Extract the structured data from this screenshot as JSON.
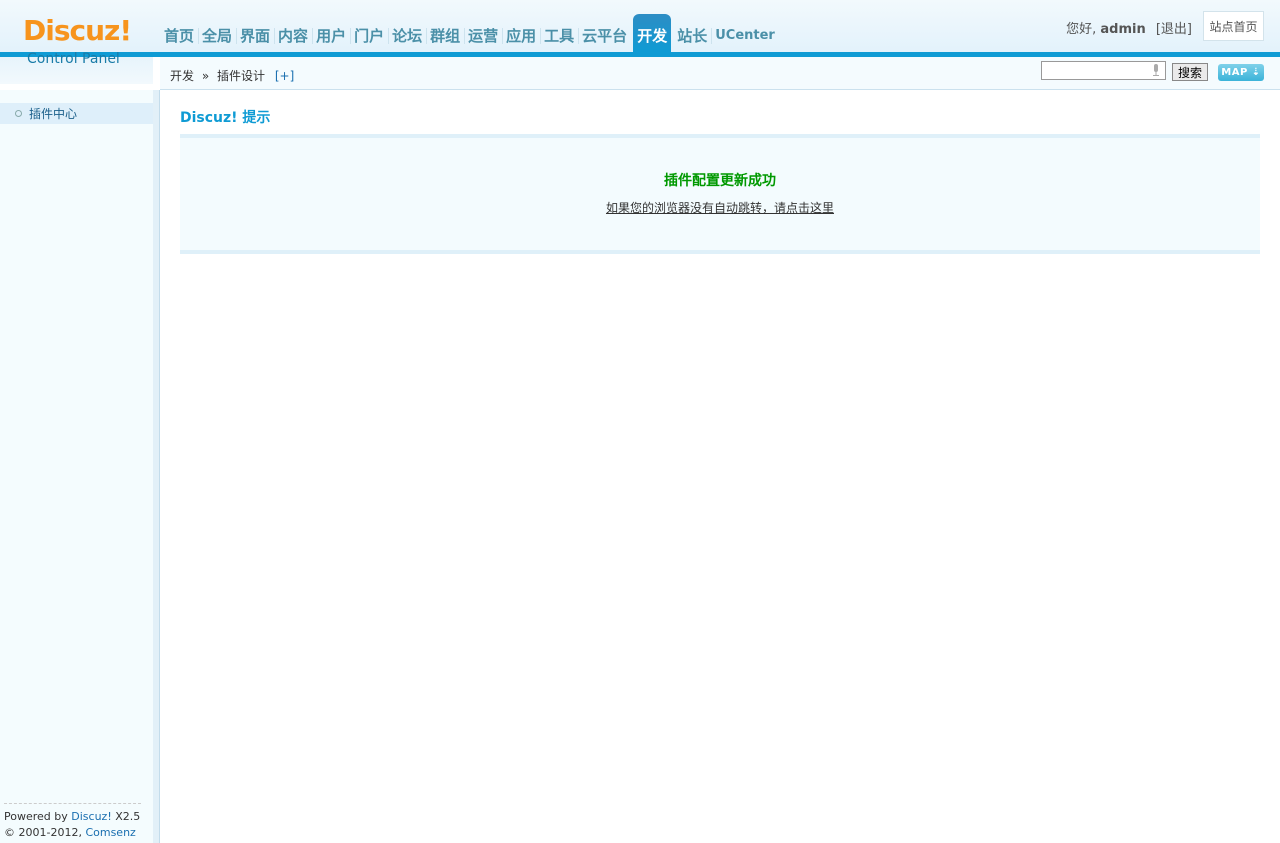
{
  "logo": {
    "brand": "Discuz!",
    "subtitle": "Control Panel"
  },
  "nav": {
    "items": [
      {
        "label": "首页"
      },
      {
        "label": "全局"
      },
      {
        "label": "界面"
      },
      {
        "label": "内容"
      },
      {
        "label": "用户"
      },
      {
        "label": "门户"
      },
      {
        "label": "论坛"
      },
      {
        "label": "群组"
      },
      {
        "label": "运营"
      },
      {
        "label": "应用"
      },
      {
        "label": "工具"
      },
      {
        "label": "云平台"
      },
      {
        "label": "开发",
        "active": true
      },
      {
        "label": "站长"
      },
      {
        "label": "UCenter"
      }
    ]
  },
  "user": {
    "greeting": "您好,",
    "name": "admin",
    "logout": "[退出]",
    "site_home": "站点首页"
  },
  "breadcrumb": {
    "root": "开发",
    "sep": "»",
    "current": "插件设计",
    "add": "[+]"
  },
  "search": {
    "value": "",
    "button": "搜索",
    "map_button": "MAP ⇣"
  },
  "sidebar": {
    "items": [
      {
        "label": "插件中心"
      }
    ],
    "footer_powered": "Powered by",
    "footer_brand": "Discuz!",
    "footer_version": " X2.5",
    "footer_copy": "© 2001-2012,",
    "footer_company": "Comsenz Inc."
  },
  "main": {
    "title": "Discuz! 提示",
    "message": "插件配置更新成功",
    "redirect_link": "如果您的浏览器没有自动跳转，请点击这里"
  },
  "colors": {
    "accent": "#0f9bd4",
    "brand": "#f7941d",
    "success": "#009900"
  }
}
